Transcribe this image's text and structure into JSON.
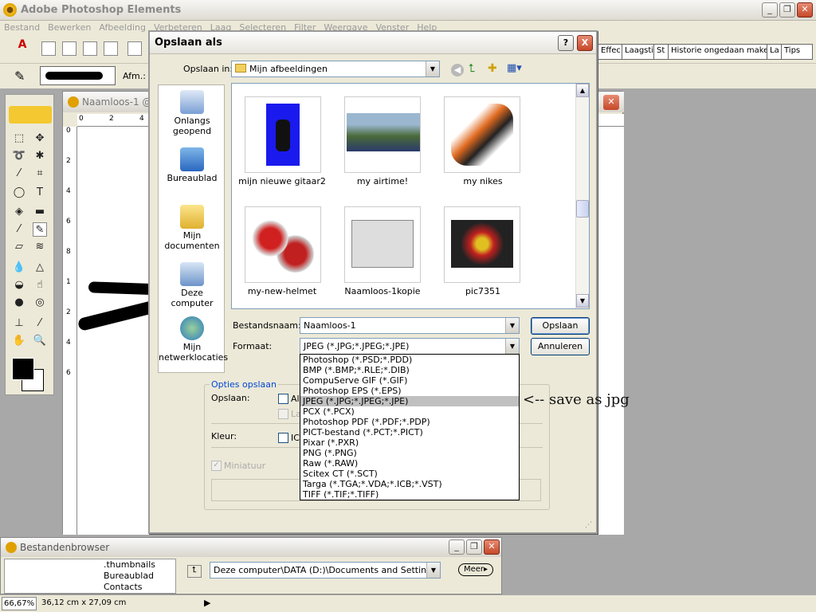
{
  "app": {
    "title": "Adobe Photoshop Elements"
  },
  "menubar": [
    "Bestand",
    "Bewerken",
    "Afbeelding",
    "Verbeteren",
    "Laag",
    "Selecteren",
    "Filter",
    "Weergave",
    "Venster",
    "Help"
  ],
  "palette_well": [
    "Effec",
    "Laagsti",
    "St",
    "Historie ongedaan maken",
    "La",
    "Tips"
  ],
  "options_bar": {
    "size_label": "Afm.:"
  },
  "document": {
    "title": "Naamloos-1 @",
    "ruler_top": [
      "0",
      "2",
      "4"
    ],
    "ruler_left": [
      "0",
      "2",
      "4",
      "6",
      "8",
      "1",
      "2",
      "4",
      "6"
    ]
  },
  "dialog": {
    "title": "Opslaan als",
    "help_btn": "?",
    "close_btn": "X",
    "save_in_label": "Opslaan in:",
    "save_in_value": "Mijn afbeeldingen",
    "places": [
      {
        "label": "Onlangs geopend",
        "icon": "recent-icon"
      },
      {
        "label": "Bureaublad",
        "icon": "desktop-icon"
      },
      {
        "label": "Mijn documenten",
        "icon": "my-documents-icon"
      },
      {
        "label": "Deze computer",
        "icon": "my-computer-icon"
      },
      {
        "label": "Mijn netwerklocaties",
        "icon": "network-icon"
      }
    ],
    "files": [
      {
        "name": "mijn nieuwe gitaar2"
      },
      {
        "name": "my airtime!"
      },
      {
        "name": "my nikes"
      },
      {
        "name": "my-new-helmet"
      },
      {
        "name": "Naamloos-1kopie"
      },
      {
        "name": "pic7351"
      }
    ],
    "filename_label": "Bestandsnaam:",
    "filename_value": "Naamloos-1",
    "format_label": "Formaat:",
    "format_value": "JPEG (*.JPG;*.JPEG;*.JPE)",
    "save_button": "Opslaan",
    "cancel_button": "Annuleren",
    "options_group": "Opties opslaan",
    "save_opt_label": "Opslaan:",
    "save_opt_1": "Al",
    "save_opt_2": "La",
    "color_label": "Kleur:",
    "color_opt": "IC",
    "thumbnail_label": "Miniatuur",
    "format_options": [
      "Photoshop (*.PSD;*.PDD)",
      "BMP (*.BMP;*.RLE;*.DIB)",
      "CompuServe GIF (*.GIF)",
      "Photoshop EPS (*.EPS)",
      "JPEG (*.JPG;*.JPEG;*.JPE)",
      "PCX (*.PCX)",
      "Photoshop PDF (*.PDF;*.PDP)",
      "PICT-bestand (*.PCT;*.PICT)",
      "Pixar (*.PXR)",
      "PNG (*.PNG)",
      "Raw (*.RAW)",
      "Scitex CT (*.SCT)",
      "Targa (*.TGA;*.VDA;*.ICB;*.VST)",
      "TIFF (*.TIF;*.TIFF)"
    ],
    "selected_format_index": 4
  },
  "annotation": "<-- save as jpg",
  "file_browser": {
    "title": "Bestandenbrowser",
    "tree": [
      ".thumbnails",
      "Bureaublad",
      "Contacts"
    ],
    "path": "Deze computer\\DATA (D:)\\Documents and Settin...",
    "more_button": "Meer"
  },
  "status": {
    "zoom": "66,67%",
    "size": "36,12 cm x 27,09 cm"
  }
}
